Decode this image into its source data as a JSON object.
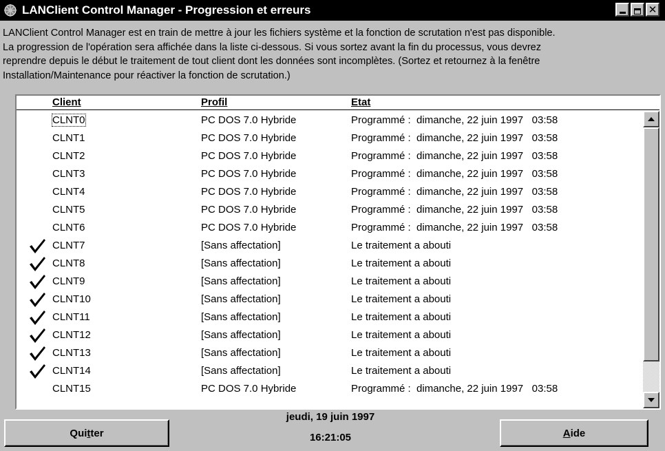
{
  "window": {
    "title": "LANClient Control Manager - Progression et erreurs",
    "minimize_icon": "minimize-icon",
    "maximize_icon": "maximize-icon",
    "close_label": "✕"
  },
  "description": {
    "line1": "LANClient Control Manager est en train de mettre à jour les fichiers système et la fonction de scrutation n'est pas disponible.",
    "line2": "La progression de l'opération sera affichée dans la liste ci-dessous. Si vous sortez avant la fin du processus, vous devrez",
    "line3": "reprendre depuis le début le traitement de tout client dont les données sont incomplètes. (Sortez et retournez à la fenêtre",
    "line4": "Installation/Maintenance pour réactiver la fonction de scrutation.)"
  },
  "list": {
    "columns": {
      "client": "Client",
      "profile": "Profil",
      "status": "Etat"
    },
    "rows": [
      {
        "client": "CLNT0",
        "profile": "PC DOS 7.0 Hybride",
        "status": "Programmé :  dimanche, 22 juin 1997   03:58",
        "done": false,
        "focused": true
      },
      {
        "client": "CLNT1",
        "profile": "PC DOS 7.0 Hybride",
        "status": "Programmé :  dimanche, 22 juin 1997   03:58",
        "done": false
      },
      {
        "client": "CLNT2",
        "profile": "PC DOS 7.0 Hybride",
        "status": "Programmé :  dimanche, 22 juin 1997   03:58",
        "done": false
      },
      {
        "client": "CLNT3",
        "profile": "PC DOS 7.0 Hybride",
        "status": "Programmé :  dimanche, 22 juin 1997   03:58",
        "done": false
      },
      {
        "client": "CLNT4",
        "profile": "PC DOS 7.0 Hybride",
        "status": "Programmé :  dimanche, 22 juin 1997   03:58",
        "done": false
      },
      {
        "client": "CLNT5",
        "profile": "PC DOS 7.0 Hybride",
        "status": "Programmé :  dimanche, 22 juin 1997   03:58",
        "done": false
      },
      {
        "client": "CLNT6",
        "profile": "PC DOS 7.0 Hybride",
        "status": "Programmé :  dimanche, 22 juin 1997   03:58",
        "done": false
      },
      {
        "client": "CLNT7",
        "profile": "[Sans affectation]",
        "status": "Le traitement a abouti",
        "done": true
      },
      {
        "client": "CLNT8",
        "profile": "[Sans affectation]",
        "status": "Le traitement a abouti",
        "done": true
      },
      {
        "client": "CLNT9",
        "profile": "[Sans affectation]",
        "status": "Le traitement a abouti",
        "done": true
      },
      {
        "client": "CLNT10",
        "profile": "[Sans affectation]",
        "status": "Le traitement a abouti",
        "done": true
      },
      {
        "client": "CLNT11",
        "profile": "[Sans affectation]",
        "status": "Le traitement a abouti",
        "done": true
      },
      {
        "client": "CLNT12",
        "profile": "[Sans affectation]",
        "status": "Le traitement a abouti",
        "done": true
      },
      {
        "client": "CLNT13",
        "profile": "[Sans affectation]",
        "status": "Le traitement a abouti",
        "done": true
      },
      {
        "client": "CLNT14",
        "profile": "[Sans affectation]",
        "status": "Le traitement a abouti",
        "done": true
      },
      {
        "client": "CLNT15",
        "profile": "PC DOS 7.0 Hybride",
        "status": "Programmé :  dimanche, 22 juin 1997   03:58",
        "done": false
      }
    ],
    "check_icon": "checkmark-icon"
  },
  "footer": {
    "quit_label": "Quitter",
    "quit_mnemonic_index": 3,
    "help_label": "Aide",
    "help_mnemonic_index": 0,
    "date": "jeudi, 19 juin 1997",
    "time": "16:21:05"
  },
  "colors": {
    "titlebar_bg": "#000000",
    "titlebar_text": "#ffffff",
    "face": "#c0c0c0",
    "list_bg": "#ffffff"
  }
}
